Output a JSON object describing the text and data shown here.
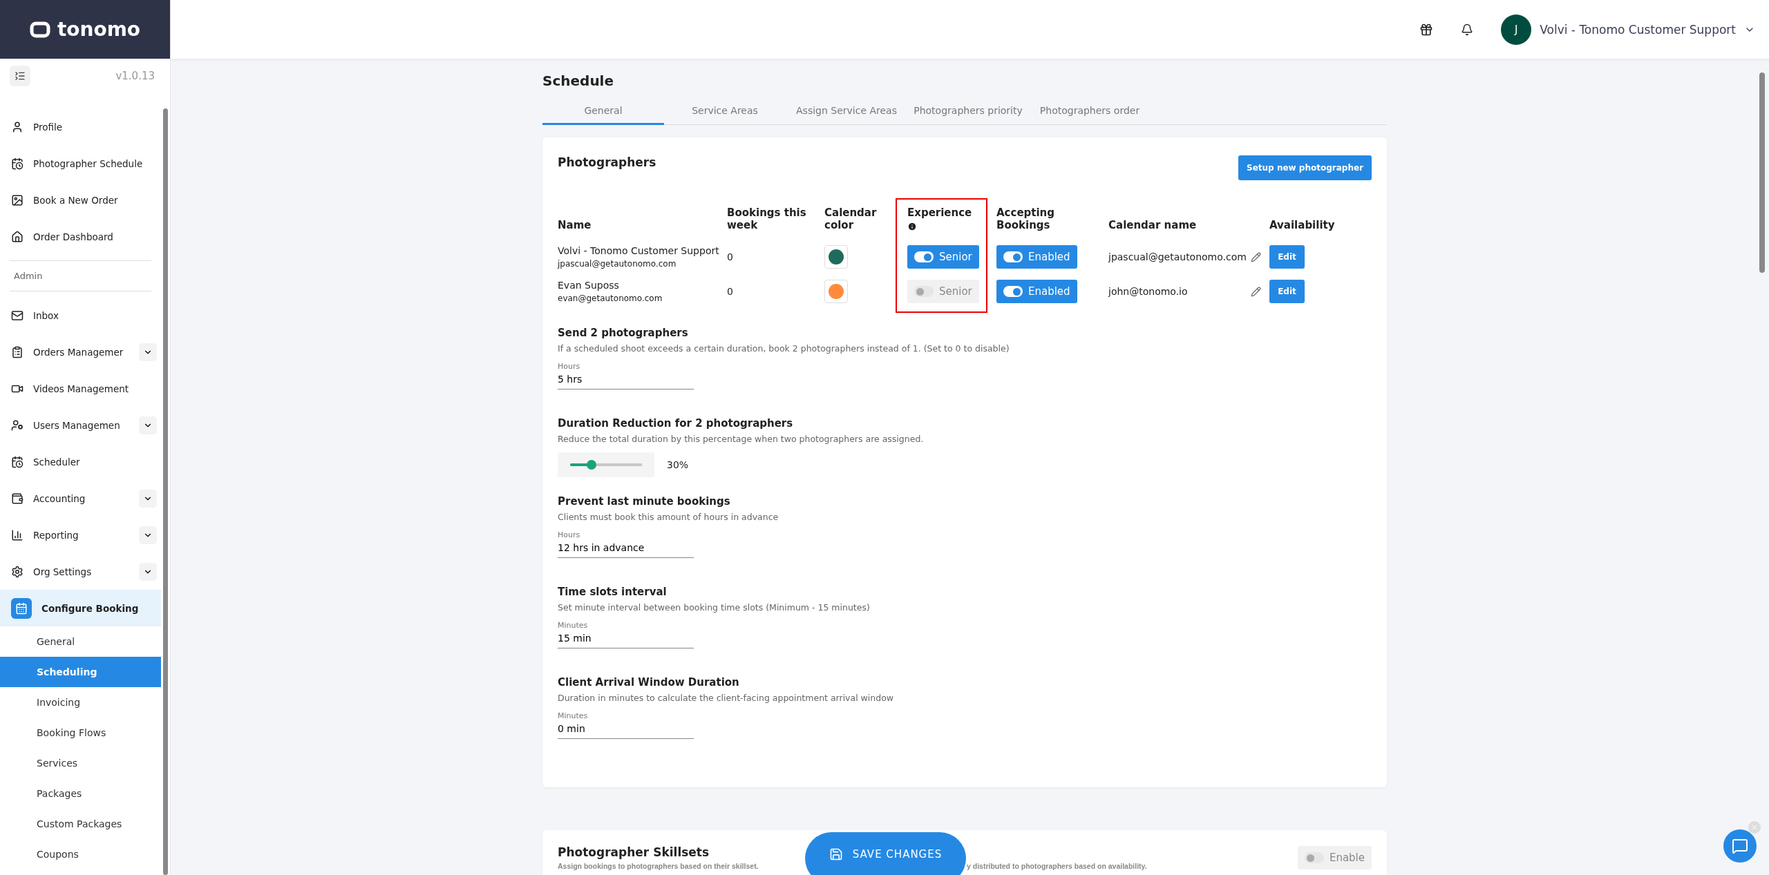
{
  "brand": {
    "logo_text": "tonomo",
    "version": "v1.0.13"
  },
  "header": {
    "avatar_letter": "J",
    "user_name": "Volvi - Tonomo Customer Support"
  },
  "sidebar": {
    "items": [
      {
        "label": "Profile",
        "kind": "link"
      },
      {
        "label": "Photographer Schedule",
        "kind": "link"
      },
      {
        "label": "Book a New Order",
        "kind": "link"
      },
      {
        "label": "Order Dashboard",
        "kind": "link"
      },
      {
        "label": "Admin",
        "kind": "section"
      },
      {
        "label": "Inbox",
        "kind": "link"
      },
      {
        "label": "Orders Managemer",
        "kind": "group",
        "expanded": false
      },
      {
        "label": "Videos Management",
        "kind": "link"
      },
      {
        "label": "Users Managemen",
        "kind": "group",
        "expanded": false
      },
      {
        "label": "Scheduler",
        "kind": "link"
      },
      {
        "label": "Accounting",
        "kind": "group",
        "expanded": false
      },
      {
        "label": "Reporting",
        "kind": "group",
        "expanded": false
      },
      {
        "label": "Org Settings",
        "kind": "group",
        "expanded": false
      },
      {
        "label": "Configure Booking",
        "kind": "group",
        "expanded": true,
        "children": [
          {
            "label": "General",
            "selected": false
          },
          {
            "label": "Scheduling",
            "selected": true
          },
          {
            "label": "Invoicing",
            "selected": false
          },
          {
            "label": "Booking Flows",
            "selected": false
          },
          {
            "label": "Services",
            "selected": false
          },
          {
            "label": "Packages",
            "selected": false
          },
          {
            "label": "Custom Packages",
            "selected": false
          },
          {
            "label": "Coupons",
            "selected": false
          }
        ]
      }
    ]
  },
  "page": {
    "title": "Schedule",
    "tabs": [
      {
        "label": "General",
        "selected": true
      },
      {
        "label": "Service Areas",
        "selected": false
      },
      {
        "label": "Assign Service Areas",
        "selected": false
      },
      {
        "label": "Photographers priority",
        "selected": false
      },
      {
        "label": "Photographers order",
        "selected": false
      }
    ]
  },
  "photographers": {
    "title": "Photographers",
    "setup_button": "Setup new photographer",
    "columns": [
      {
        "label": "Name",
        "highlighted": false
      },
      {
        "label": "Bookings this week",
        "highlighted": false
      },
      {
        "label": "Calendar color",
        "highlighted": false
      },
      {
        "label": "Experience",
        "highlighted": true,
        "info": true
      },
      {
        "label": "Accepting Bookings",
        "highlighted": false
      },
      {
        "label": "Calendar name",
        "highlighted": false
      },
      {
        "label": "Availability",
        "highlighted": false
      }
    ],
    "rows": [
      {
        "name": "Volvi - Tonomo Customer Support",
        "email": "jpascual@getautonomo.com",
        "bookings": "0",
        "color": "#1e6b5c",
        "experience_label": "Senior",
        "senior": true,
        "accepting_label": "Enabled",
        "accepting": true,
        "calendar_name": "jpascual@getautonomo.com",
        "edit": "Edit"
      },
      {
        "name": "Evan Suposs",
        "email": "evan@getautonomo.com",
        "bookings": "0",
        "color": "#ff8a3d",
        "experience_label": "Senior",
        "senior": false,
        "accepting_label": "Enabled",
        "accepting": true,
        "calendar_name": "john@tonomo.io",
        "edit": "Edit"
      }
    ]
  },
  "settings": [
    {
      "kind": "field",
      "title": "Send 2 photographers",
      "description": "If a scheduled shoot exceeds a certain duration, book 2 photographers instead of 1. (Set to 0 to disable)",
      "label": "Hours",
      "value": "5 hrs"
    },
    {
      "kind": "slider",
      "title": "Duration Reduction for 2 photographers",
      "description": "Reduce the total duration by this percentage when two photographers are assigned.",
      "level": 0.3,
      "reading": "30%"
    },
    {
      "kind": "field",
      "title": "Prevent last minute bookings",
      "description": "Clients must book this amount of hours in advance",
      "label": "Hours",
      "value": "12 hrs in advance"
    },
    {
      "kind": "field",
      "title": "Time slots interval",
      "description": "Set minute interval between booking time slots (Minimum - 15 minutes)",
      "label": "Minutes",
      "value": "15 min"
    },
    {
      "kind": "field",
      "title": "Client Arrival Window Duration",
      "description": "Duration in minutes to calculate the client-facing appointment arrival window",
      "label": "Minutes",
      "value": "0 min"
    }
  ],
  "skillsets": {
    "title": "Photographer Skillsets",
    "description_parts": [
      "Assign bookings to photographers based on their skillset.",
      "y distributed to photographers based on availability."
    ],
    "toggle_label": "Enable",
    "enabled": false
  },
  "save_button": "SAVE CHANGES"
}
